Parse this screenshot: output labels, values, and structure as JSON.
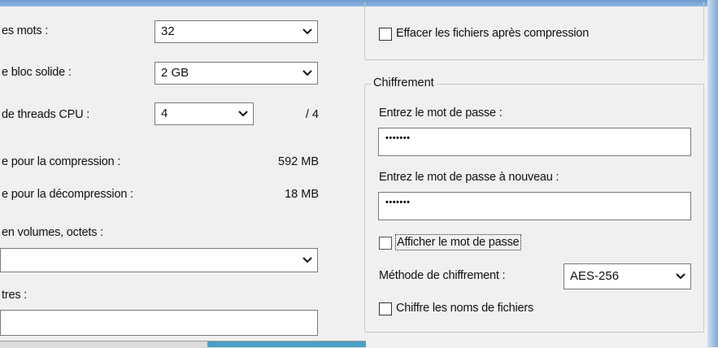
{
  "left": {
    "word_size_label": "es mots :",
    "word_size_value": "32",
    "solid_block_label": "e bloc solide :",
    "solid_block_value": "2 GB",
    "threads_label": "de threads CPU :",
    "threads_value": "4",
    "threads_max": "/ 4",
    "mem_compress_label": "e pour la compression :",
    "mem_compress_value": "592 MB",
    "mem_decompress_label": "e pour la décompression :",
    "mem_decompress_value": "18 MB",
    "volumes_label": "en volumes, octets :",
    "volumes_value": "",
    "params_label": "tres :",
    "params_value": ""
  },
  "right": {
    "delete_after_label": "Effacer les fichiers après compression",
    "encryption": {
      "group_title": "Chiffrement",
      "password_label": "Entrez le mot de passe :",
      "password_value": "•••••••",
      "password_again_label": "Entrez le mot de passe à nouveau :",
      "password_again_value": "•••••••",
      "show_password_label": "Afficher le mot de passe",
      "method_label": "Méthode de chiffrement :",
      "method_value": "AES-256",
      "encrypt_names_label": "Chiffre les noms de fichiers"
    }
  },
  "colors": {
    "window_bg": "#f0f0f0",
    "field_border": "#7a7a7a",
    "top_bar": "#5b8fc7",
    "taskbar_blue": "#4aa0c8"
  },
  "icons": {
    "dropdown": "chevron-down-icon"
  }
}
